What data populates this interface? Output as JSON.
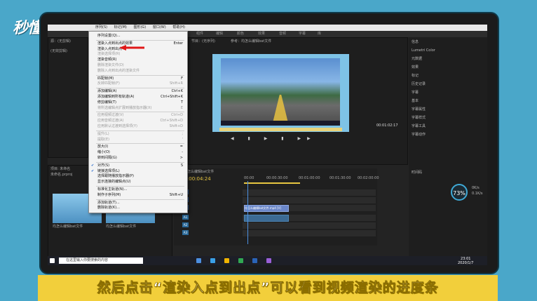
{
  "watermark": "秒懂视频",
  "menubar": {
    "items": [
      "序列(S)",
      "标记(M)",
      "图形(G)",
      "窗口(W)",
      "帮助(H)"
    ]
  },
  "workspace_tabs": [
    "组件",
    "编辑",
    "颜色",
    "效果",
    "音频",
    "字幕",
    "库"
  ],
  "program_monitor": {
    "title": "节目：(无序列)",
    "sequence_label": "参考：均怎么编辑bat文件",
    "fit": "完整",
    "timecode": "00:01:02:17"
  },
  "source_panel": {
    "title": "源：(无剪辑)",
    "empty_text": "(无效剪辑)"
  },
  "timeline": {
    "title": "均怎么编辑bat文件",
    "timecode": "00:00:04:24",
    "ruler": [
      "00:00",
      "00:00:30:00",
      "00:01:00:00",
      "00:01:30:00",
      "00:02:00:00"
    ],
    "video_tracks": [
      "V3",
      "V2",
      "V1"
    ],
    "audio_tracks": [
      "A1",
      "A2",
      "A3"
    ],
    "clip_label": "均怎么编辑bat文件.mp4 [V]"
  },
  "project_panel": {
    "title": "项目: 未命名",
    "item_count": "未命名.prproj",
    "thumbnails": [
      "均怎么编辑bat文件",
      "均怎么编辑bat文件"
    ]
  },
  "dropdown": {
    "items": [
      {
        "label": "序列设置(Q)...",
        "shortcut": "",
        "disabled": false
      },
      {
        "label": "渲染入点到出点的效果",
        "shortcut": "Enter",
        "disabled": false
      },
      {
        "label": "渲染入点到出点",
        "shortcut": "",
        "disabled": false,
        "target": true
      },
      {
        "label": "渲染选择项(R)",
        "shortcut": "",
        "disabled": true
      },
      {
        "label": "渲染音频(R)",
        "shortcut": "",
        "disabled": false
      },
      {
        "label": "删除渲染文件(D)",
        "shortcut": "",
        "disabled": true
      },
      {
        "label": "删除入点到出点的渲染文件",
        "shortcut": "",
        "disabled": true
      },
      {
        "label": "匹配帧(M)",
        "shortcut": "F",
        "disabled": false
      },
      {
        "label": "反转匹配帧(F)",
        "shortcut": "Shift+R",
        "disabled": true
      },
      {
        "label": "添加编辑(A)",
        "shortcut": "Ctrl+K",
        "disabled": false
      },
      {
        "label": "添加编辑到所有轨道(A)",
        "shortcut": "Ctrl+Shift+K",
        "disabled": false
      },
      {
        "label": "修剪编辑(T)",
        "shortcut": "T",
        "disabled": false
      },
      {
        "label": "将所选编辑点扩展到播放指示器(X)",
        "shortcut": "E",
        "disabled": true
      },
      {
        "label": "应用视频过渡(V)",
        "shortcut": "Ctrl+D",
        "disabled": true
      },
      {
        "label": "应用音频过渡(A)",
        "shortcut": "Ctrl+Shift+D",
        "disabled": true
      },
      {
        "label": "应用默认过渡到选择项(Y)",
        "shortcut": "Shift+D",
        "disabled": true
      },
      {
        "label": "提升(L)",
        "shortcut": ";",
        "disabled": true
      },
      {
        "label": "提取(E)",
        "shortcut": "'",
        "disabled": true
      },
      {
        "label": "放大(I)",
        "shortcut": "=",
        "disabled": false
      },
      {
        "label": "缩小(O)",
        "shortcut": "-",
        "disabled": false
      },
      {
        "label": "转到间隔(G)",
        "shortcut": ">",
        "disabled": false
      },
      {
        "label": "对齐(S)",
        "shortcut": "S",
        "disabled": false,
        "checked": true
      },
      {
        "label": "链接选择项(L)",
        "shortcut": "",
        "disabled": false,
        "checked": true
      },
      {
        "label": "选择跟随播放指示器(P)",
        "shortcut": "",
        "disabled": false
      },
      {
        "label": "显示连接的编辑点(U)",
        "shortcut": "",
        "disabled": false
      },
      {
        "label": "标准化主轨道(N)...",
        "shortcut": "",
        "disabled": false
      },
      {
        "label": "制作子序列(M)",
        "shortcut": "Shift+U",
        "disabled": false
      },
      {
        "label": "添加轨道(T)...",
        "shortcut": "",
        "disabled": false
      },
      {
        "label": "删除轨道(K)...",
        "shortcut": "",
        "disabled": false
      }
    ]
  },
  "right_panel": {
    "items": [
      "信息",
      "Lumetri Color",
      "元数据",
      "效果",
      "标记",
      "历史记录",
      "字幕",
      "基本",
      "字幕属性",
      "字幕样式",
      "字幕工具",
      "字幕动作",
      "时间码"
    ]
  },
  "perf_widget": {
    "percent": "73%",
    "up": "0K/s",
    "down": "0.1K/s"
  },
  "taskbar": {
    "search_placeholder": "在这里输入你要搜索的内容",
    "time": "23:01",
    "date": "2020/1/7"
  },
  "caption": "然后点击“渲染入点到出点”可以看到视频渲染的进度条",
  "colors": {
    "frame_bg": "#4aa7c9",
    "caption_bg": "#f2cf3b",
    "accent_arrow": "#e01818"
  }
}
